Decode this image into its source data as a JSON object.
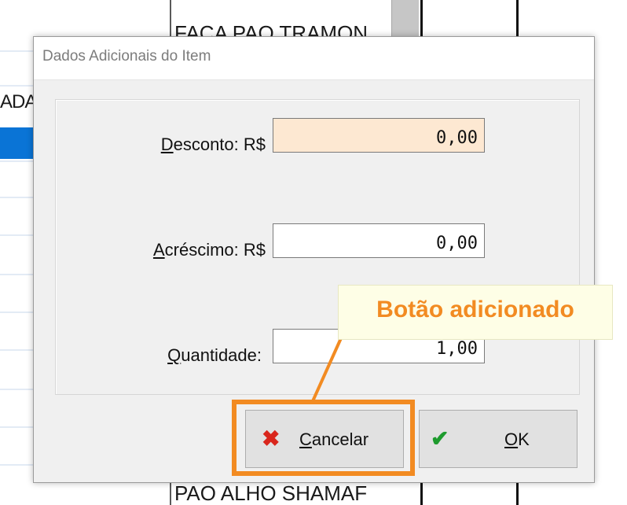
{
  "background": {
    "row_text_top": "FACA PAO TRAMON",
    "row_text_left": "ADA",
    "row_text_bottom": "PAO ALHO SHAMAF"
  },
  "dialog": {
    "title": "Dados Adicionais do Item",
    "fields": [
      {
        "label": "Desconto: R$",
        "accel": "D",
        "rest": "esconto: R$",
        "value": "0,00",
        "focused": true
      },
      {
        "label": "Acréscimo: R$",
        "accel": "A",
        "rest": "créscimo: R$",
        "value": "0,00",
        "focused": false
      },
      {
        "label": "Quantidade:",
        "accel": "Q",
        "rest": "uantidade:",
        "value": "1,00",
        "focused": false
      }
    ],
    "buttons": {
      "cancel": {
        "accel": "C",
        "rest": "ancelar",
        "icon": "x-icon",
        "icon_color": "#d9261c"
      },
      "ok": {
        "accel": "O",
        "rest": "K",
        "icon": "check-icon",
        "icon_color": "#1e9b2e"
      }
    }
  },
  "annotation": {
    "text": "Botão adicionado",
    "color": "#f28b22"
  }
}
